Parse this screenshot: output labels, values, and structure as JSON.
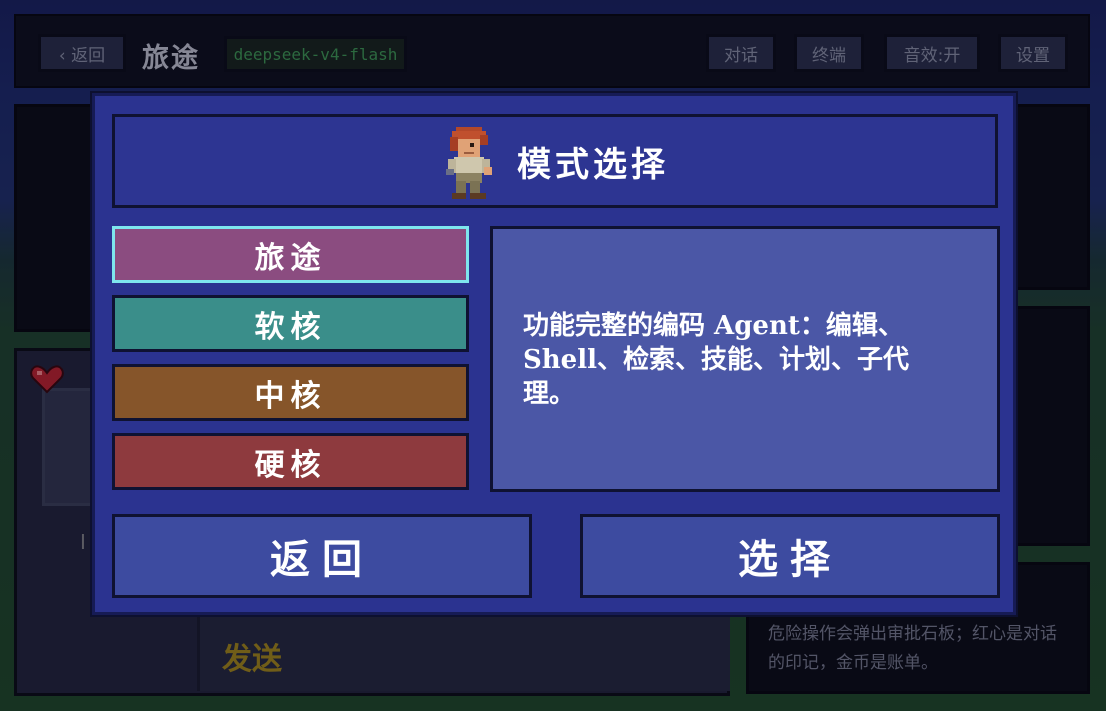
{
  "topbar": {
    "back_label": "‹ 返回",
    "title": "旅途",
    "model": "deepseek-v4-flash",
    "chat_label": "对话",
    "terminal_label": "终端",
    "sound_label": "音效:开",
    "settings_label": "设置"
  },
  "background": {
    "send_label": "发送",
    "hint_text": "危险操作会弹出审批石板；红心是对话的印记，金币是账单。",
    "partial_letter": "I"
  },
  "modal": {
    "title": "模式选择",
    "modes": [
      {
        "label": "旅途",
        "color": "#8b4c80",
        "selected": true
      },
      {
        "label": "软核",
        "color": "#3a8e8a",
        "selected": false
      },
      {
        "label": "中核",
        "color": "#86552a",
        "selected": false
      },
      {
        "label": "硬核",
        "color": "#8e3a3e",
        "selected": false
      }
    ],
    "description": "功能完整的编码 Agent：编辑、Shell、检索、技能、计划、子代理。",
    "back_label": "返回",
    "select_label": "选择"
  },
  "icons": {
    "header_character": "guide-character-icon",
    "life": "heart-icon"
  },
  "colors": {
    "modal_bg": "#2b3390",
    "desc_bg": "#4b57a6",
    "selected_border": "#7ee6ee",
    "send_text": "#a88b16",
    "model_text": "#3f9d52"
  }
}
